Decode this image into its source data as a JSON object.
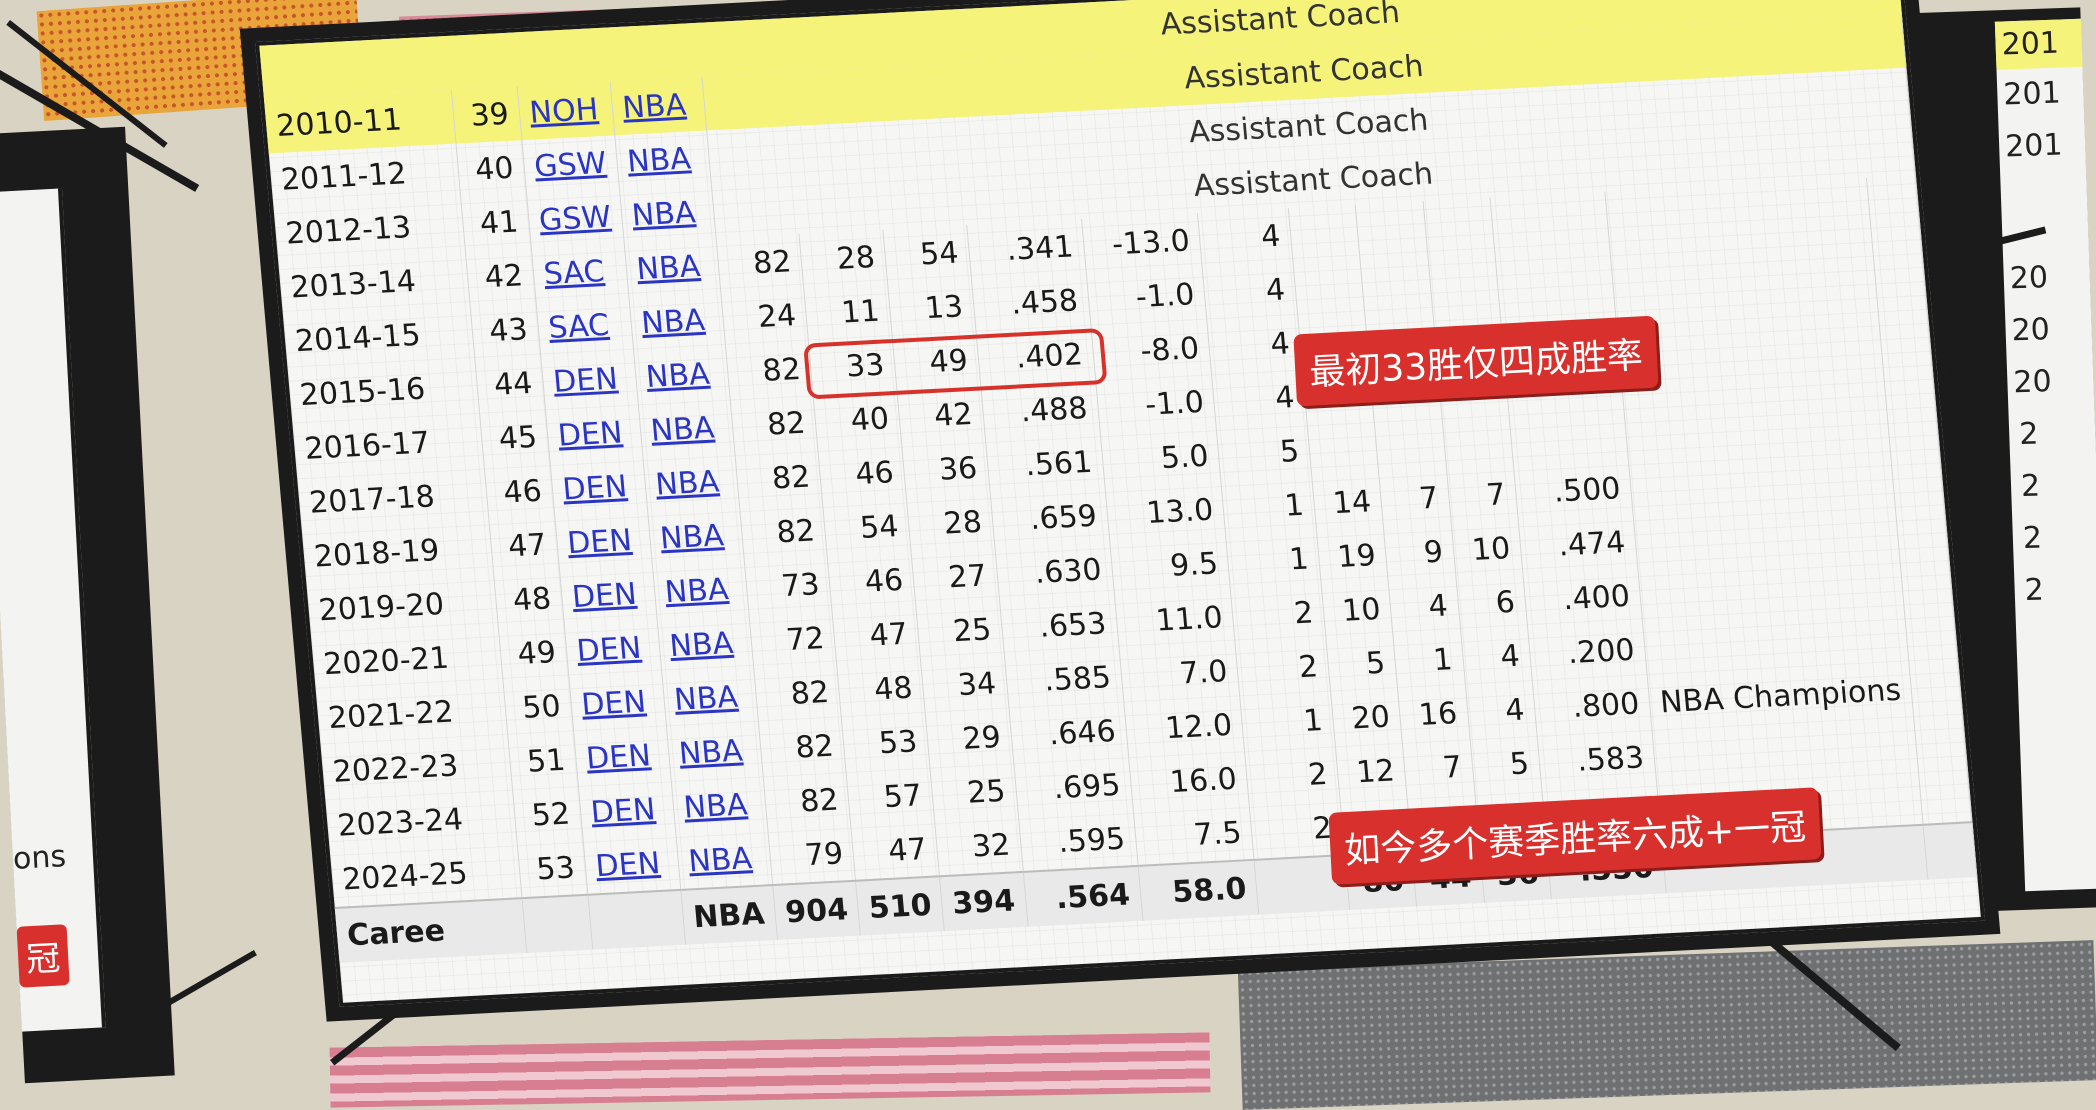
{
  "banner_role": "Assistant Coach",
  "rows": [
    {
      "season": "2010-11",
      "age": "39",
      "team": "NOH",
      "lg": "NBA",
      "role": "Assistant Coach",
      "hl": true
    },
    {
      "season": "2011-12",
      "age": "40",
      "team": "GSW",
      "lg": "NBA",
      "role": "Assistant Coach"
    },
    {
      "season": "2012-13",
      "age": "41",
      "team": "GSW",
      "lg": "NBA",
      "role": "Assistant Coach"
    },
    {
      "season": "2013-14",
      "age": "42",
      "team": "SAC",
      "lg": "NBA",
      "g": "82",
      "w": "28",
      "l": "54",
      "pct": ".341",
      "srs": "-13.0",
      "rank": "4"
    },
    {
      "season": "2014-15",
      "age": "43",
      "team": "SAC",
      "lg": "NBA",
      "g": "24",
      "w": "11",
      "l": "13",
      "pct": ".458",
      "srs": "-1.0",
      "rank": "4"
    },
    {
      "season": "2015-16",
      "age": "44",
      "team": "DEN",
      "lg": "NBA",
      "g": "82",
      "w": "33",
      "l": "49",
      "pct": ".402",
      "srs": "-8.0",
      "rank": "4"
    },
    {
      "season": "2016-17",
      "age": "45",
      "team": "DEN",
      "lg": "NBA",
      "g": "82",
      "w": "40",
      "l": "42",
      "pct": ".488",
      "srs": "-1.0",
      "rank": "4"
    },
    {
      "season": "2017-18",
      "age": "46",
      "team": "DEN",
      "lg": "NBA",
      "g": "82",
      "w": "46",
      "l": "36",
      "pct": ".561",
      "srs": "5.0",
      "rank": "5"
    },
    {
      "season": "2018-19",
      "age": "47",
      "team": "DEN",
      "lg": "NBA",
      "g": "82",
      "w": "54",
      "l": "28",
      "pct": ".659",
      "srs": "13.0",
      "rank": "1",
      "pg": "14",
      "pw": "7",
      "pl": "7",
      "ppct": ".500"
    },
    {
      "season": "2019-20",
      "age": "48",
      "team": "DEN",
      "lg": "NBA",
      "g": "73",
      "w": "46",
      "l": "27",
      "pct": ".630",
      "srs": "9.5",
      "rank": "1",
      "pg": "19",
      "pw": "9",
      "pl": "10",
      "ppct": ".474"
    },
    {
      "season": "2020-21",
      "age": "49",
      "team": "DEN",
      "lg": "NBA",
      "g": "72",
      "w": "47",
      "l": "25",
      "pct": ".653",
      "srs": "11.0",
      "rank": "2",
      "pg": "10",
      "pw": "4",
      "pl": "6",
      "ppct": ".400"
    },
    {
      "season": "2021-22",
      "age": "50",
      "team": "DEN",
      "lg": "NBA",
      "g": "82",
      "w": "48",
      "l": "34",
      "pct": ".585",
      "srs": "7.0",
      "rank": "2",
      "pg": "5",
      "pw": "1",
      "pl": "4",
      "ppct": ".200"
    },
    {
      "season": "2022-23",
      "age": "51",
      "team": "DEN",
      "lg": "NBA",
      "g": "82",
      "w": "53",
      "l": "29",
      "pct": ".646",
      "srs": "12.0",
      "rank": "1",
      "pg": "20",
      "pw": "16",
      "pl": "4",
      "ppct": ".800",
      "note": "NBA Champions"
    },
    {
      "season": "2023-24",
      "age": "52",
      "team": "DEN",
      "lg": "NBA",
      "g": "82",
      "w": "57",
      "l": "25",
      "pct": ".695",
      "srs": "16.0",
      "rank": "2",
      "pg": "12",
      "pw": "7",
      "pl": "5",
      "ppct": ".583"
    },
    {
      "season": "2024-25",
      "age": "53",
      "team": "DEN",
      "lg": "NBA",
      "g": "79",
      "w": "47",
      "l": "32",
      "pct": ".595",
      "srs": "7.5",
      "rank": "2"
    }
  ],
  "career": {
    "label": "Caree",
    "lg": "NBA",
    "g": "904",
    "w": "510",
    "l": "394",
    "pct": ".564",
    "srs": "58.0",
    "pg": "80",
    "pw": "44",
    "pl": "36",
    "ppct": ".550"
  },
  "callouts": {
    "early": "最初33胜仅四成胜率",
    "now": "如今多个赛季胜率六成+一冠",
    "left_edge_text": "ons",
    "left_edge_tag": "冠"
  },
  "right_peek": [
    "201",
    "201",
    "201",
    "20",
    "20",
    "20",
    "2",
    "2",
    "2",
    "2"
  ],
  "colors": {
    "highlight": "#f5f37a",
    "tag": "#d8302c",
    "link": "#2b35c4"
  }
}
